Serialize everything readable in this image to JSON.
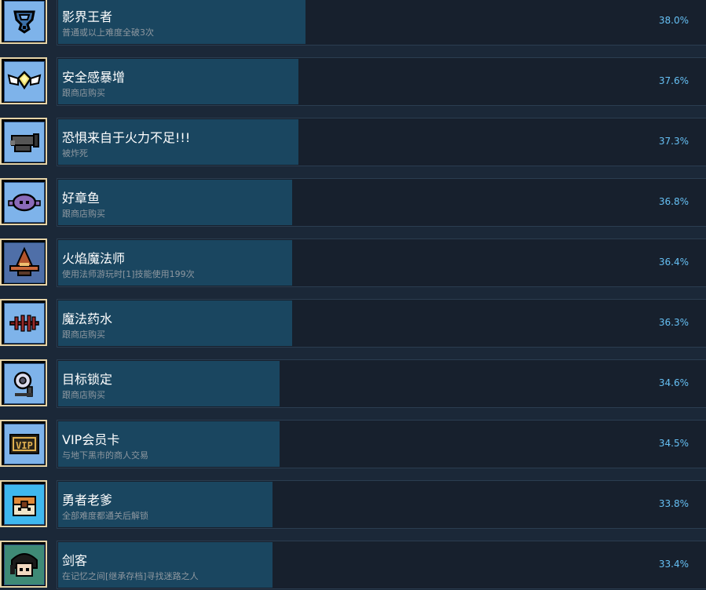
{
  "achievements": [
    {
      "title": "影界王者",
      "description": "普通或以上难度全破3次",
      "percent_label": "38.0%",
      "percent": 38.0,
      "icon": "shield-emblem-icon",
      "icon_bg": "#7eb3ea"
    },
    {
      "title": "安全感暴增",
      "description": "跟商店购买",
      "percent_label": "37.6%",
      "percent": 37.6,
      "icon": "winged-gem-icon",
      "icon_bg": "#7eb3ea"
    },
    {
      "title": "恐惧来自于火力不足!!!",
      "description": "被炸死",
      "percent_label": "37.3%",
      "percent": 37.3,
      "icon": "cannon-icon",
      "icon_bg": "#7eb3ea"
    },
    {
      "title": "好章鱼",
      "description": "跟商店购买",
      "percent_label": "36.8%",
      "percent": 36.8,
      "icon": "octopus-icon",
      "icon_bg": "#7eb3ea"
    },
    {
      "title": "火焰魔法师",
      "description": "使用法师游玩时[1]技能使用199次",
      "percent_label": "36.4%",
      "percent": 36.4,
      "icon": "wizard-hat-icon",
      "icon_bg": "#4f6fa8"
    },
    {
      "title": "魔法药水",
      "description": "跟商店购买",
      "percent_label": "36.3%",
      "percent": 36.3,
      "icon": "spiked-rod-icon",
      "icon_bg": "#7eb3ea"
    },
    {
      "title": "目标锁定",
      "description": "跟商店购买",
      "percent_label": "34.6%",
      "percent": 34.6,
      "icon": "target-scope-icon",
      "icon_bg": "#7eb3ea"
    },
    {
      "title": "VIP会员卡",
      "description": "与地下黑市的商人交易",
      "percent_label": "34.5%",
      "percent": 34.5,
      "icon": "vip-card-icon",
      "icon_bg": "#7eb3ea"
    },
    {
      "title": "勇者老爹",
      "description": "全部难度都通关后解锁",
      "percent_label": "33.8%",
      "percent": 33.8,
      "icon": "treasure-chest-icon",
      "icon_bg": "#3fb8ee"
    },
    {
      "title": "剑客",
      "description": "在记忆之间[继承存档]寻找迷路之人",
      "percent_label": "33.4%",
      "percent": 33.4,
      "icon": "swordsman-face-icon",
      "icon_bg": "#3f8a76"
    }
  ]
}
